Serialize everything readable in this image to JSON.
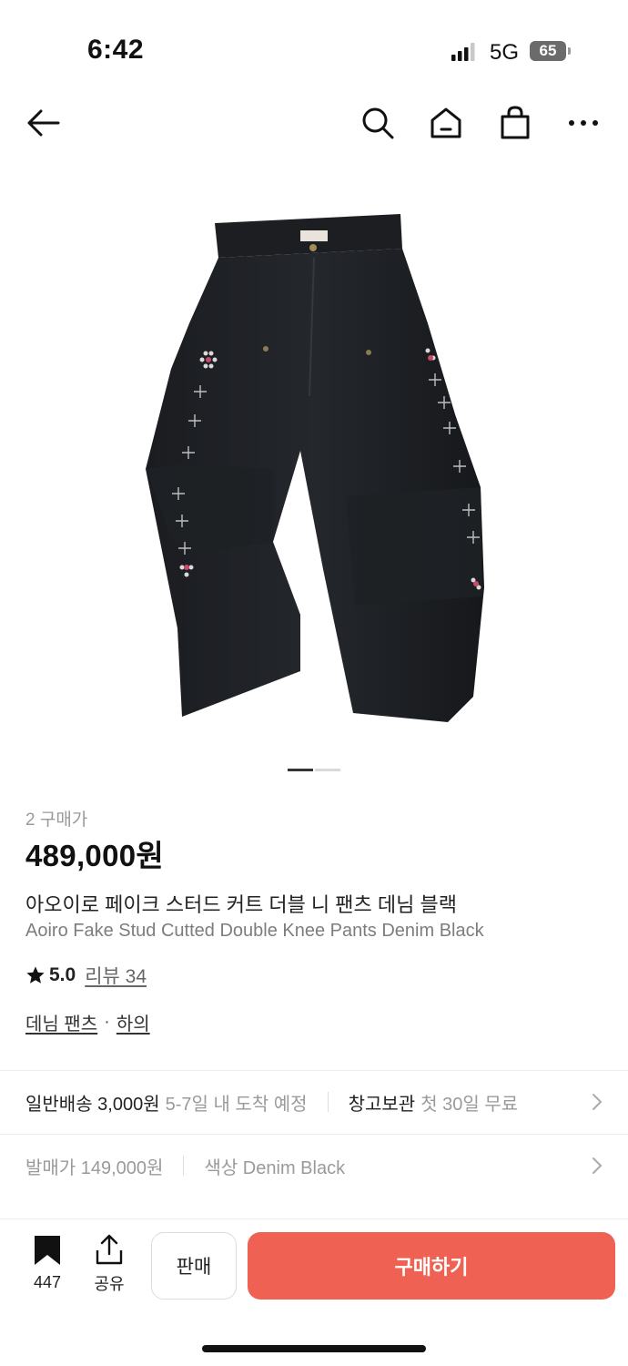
{
  "status": {
    "time": "6:42",
    "network": "5G",
    "battery": "65"
  },
  "nav": {
    "icons": [
      "back-arrow-icon",
      "search-icon",
      "home-icon",
      "shopping-bag-icon",
      "more-icon"
    ]
  },
  "gallery": {
    "image": "black denim double knee pants with stud detailing",
    "page_count": 2,
    "current_page": 1
  },
  "product": {
    "buyers_label": "2 구매가",
    "price": "489,000원",
    "title_ko": "아오이로 페이크 스터드 커트 더블 니 팬츠 데님 블랙",
    "title_en": "Aoiro Fake Stud Cutted Double Knee Pants Denim Black",
    "rating": "5.0",
    "review_label": "리뷰 34",
    "category": "데님 팬츠",
    "category_sep": "·",
    "subcategory": "하의"
  },
  "shipping": {
    "label": "일반배송 3,000원",
    "eta": "5-7일 내 도착 예정",
    "storage_label": "창고보관",
    "storage_note": "첫 30일 무료"
  },
  "release": {
    "price_label": "발매가 149,000원",
    "color_label": "색상 Denim Black"
  },
  "actions": {
    "bookmark_count": "447",
    "share_label": "공유",
    "sell_label": "판매",
    "buy_label": "구매하기",
    "buy_color": "#ef6253"
  }
}
